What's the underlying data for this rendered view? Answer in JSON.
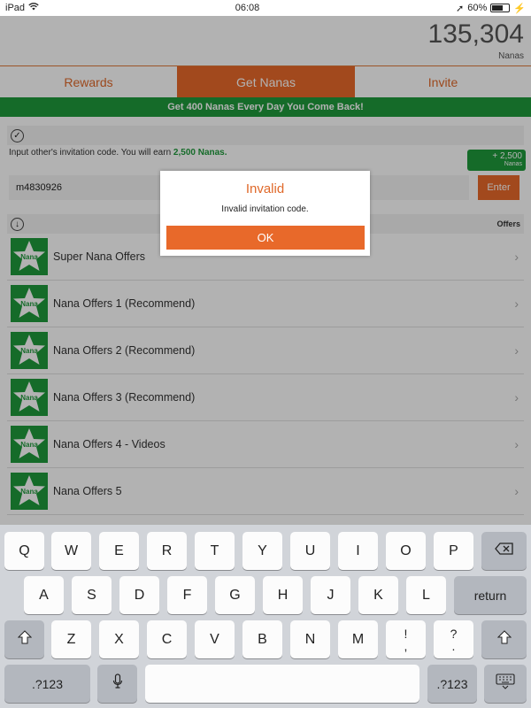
{
  "status": {
    "device": "iPad",
    "time": "06:08",
    "battery": "60%"
  },
  "header": {
    "balance": "135,304",
    "balance_unit": "Nanas"
  },
  "tabs": [
    {
      "label": "Rewards"
    },
    {
      "label": "Get Nanas"
    },
    {
      "label": "Invite"
    }
  ],
  "banner": "Get 400 Nanas Every Day You Come Back!",
  "invite": {
    "text_prefix": "Input other's invitation code. You will earn ",
    "earn_amount": "2,500 Nanas.",
    "badge_amount": "+ 2,500",
    "badge_unit": "Nanas",
    "code_value": "m4830926",
    "enter_label": "Enter"
  },
  "offers_section": {
    "label": "Offers"
  },
  "offers": [
    {
      "name": "Super Nana Offers",
      "logo_text": "Nana"
    },
    {
      "name": "Nana Offers 1 (Recommend)",
      "logo_text": "Nana"
    },
    {
      "name": "Nana Offers 2 (Recommend)",
      "logo_text": "Nana"
    },
    {
      "name": "Nana Offers 3 (Recommend)",
      "logo_text": "Nana"
    },
    {
      "name": "Nana Offers 4 - Videos",
      "logo_text": "Nana"
    },
    {
      "name": "Nana Offers 5",
      "logo_text": "Nana"
    }
  ],
  "alert": {
    "title": "Invalid",
    "message": "Invalid invitation code.",
    "ok_label": "OK"
  },
  "keyboard": {
    "row1": [
      "Q",
      "W",
      "E",
      "R",
      "T",
      "Y",
      "U",
      "I",
      "O",
      "P"
    ],
    "row2": [
      "A",
      "S",
      "D",
      "F",
      "G",
      "H",
      "J",
      "K",
      "L"
    ],
    "row3": [
      "Z",
      "X",
      "C",
      "V",
      "B",
      "N",
      "M"
    ],
    "return_label": "return",
    "numbers_label": ".?123",
    "punct1_top": "!",
    "punct1_bottom": ",",
    "punct2_top": "?",
    "punct2_bottom": "."
  },
  "colors": {
    "accent": "#e8692a",
    "brand_green": "#1f9a3c"
  }
}
